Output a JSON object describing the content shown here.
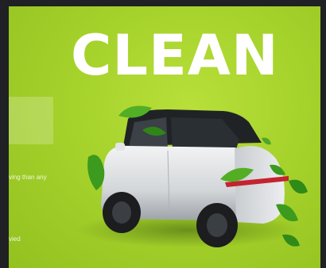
{
  "banner": {
    "headline": "CLEAN",
    "left_text_1": "ving than any",
    "left_text_2": "vied"
  },
  "colors": {
    "background": "#a6d22c",
    "frame": "#1f2124",
    "headline": "#ffffff",
    "car_body": "#d8dadd",
    "leaf": "#3f9a1c"
  },
  "icons": [
    "car-image",
    "leaf-icon"
  ]
}
